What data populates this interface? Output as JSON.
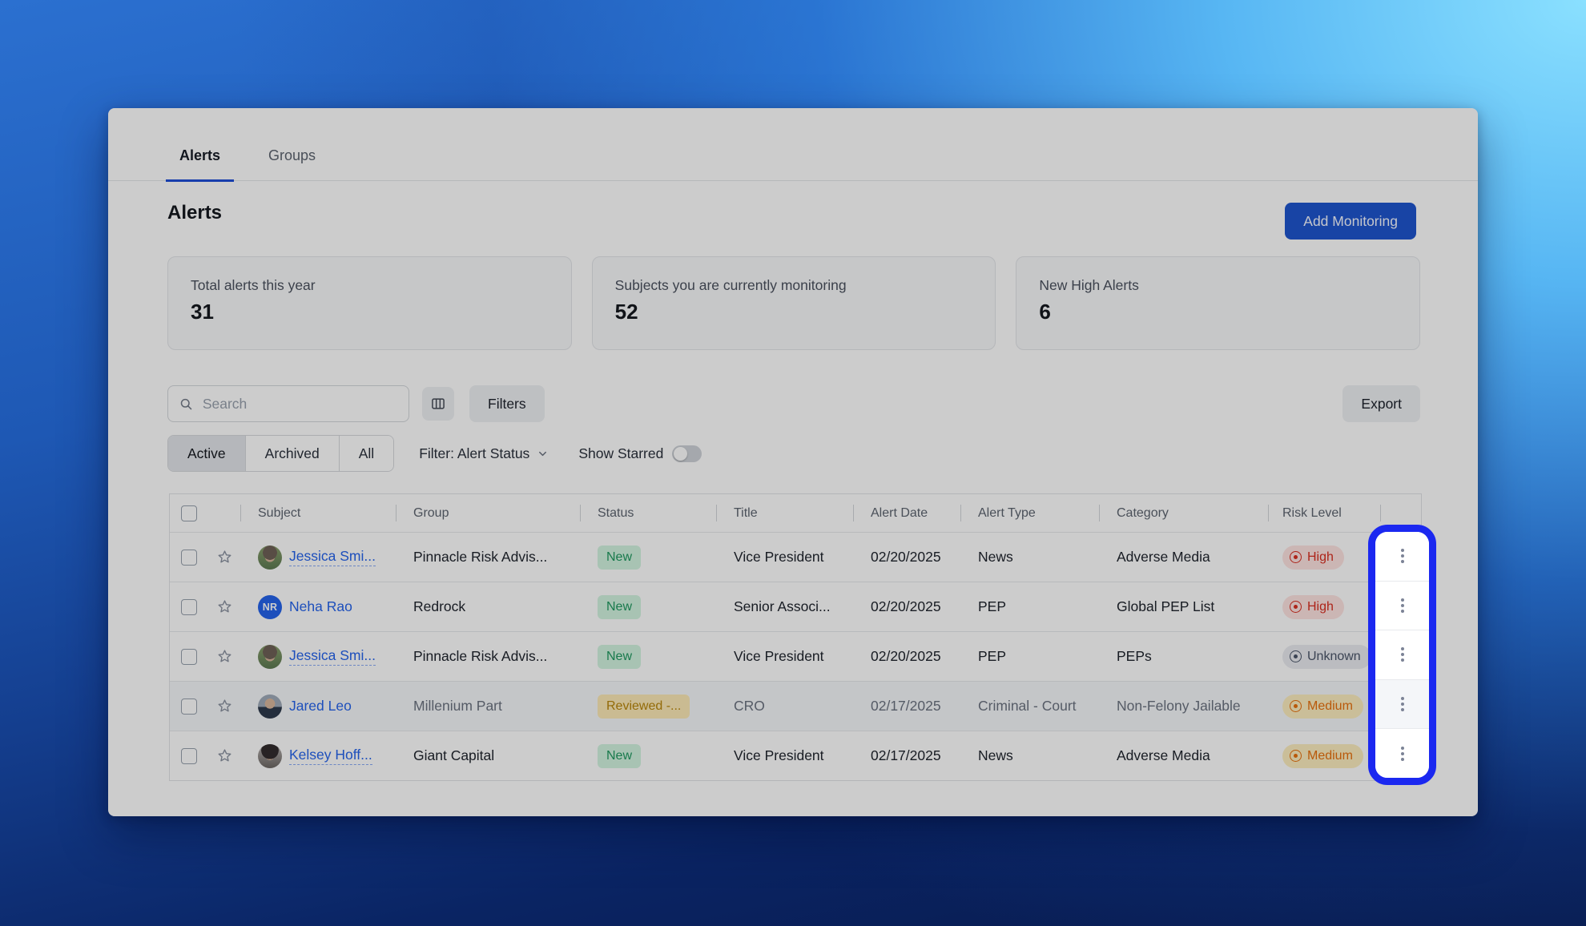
{
  "colors": {
    "accent_blue": "#1e55cf",
    "tab_underline": "#1d4ed8",
    "highlight_ring": "#1b28f0",
    "link_blue": "#2563eb"
  },
  "tabs": {
    "items": [
      {
        "label": "Alerts",
        "active": true
      },
      {
        "label": "Groups",
        "active": false
      }
    ]
  },
  "page": {
    "title": "Alerts",
    "add_monitoring_label": "Add Monitoring"
  },
  "stats": {
    "cards": [
      {
        "label": "Total alerts this year",
        "value": "31"
      },
      {
        "label": "Subjects you are currently monitoring",
        "value": "52"
      },
      {
        "label": "New High Alerts",
        "value": "6"
      }
    ]
  },
  "toolbar": {
    "search_placeholder": "Search",
    "filters_label": "Filters",
    "export_label": "Export"
  },
  "filter_bar": {
    "segments": [
      "Active",
      "Archived",
      "All"
    ],
    "active_segment": "Active",
    "filter_label": "Filter: Alert Status",
    "show_starred_label": "Show Starred",
    "starred_on": false
  },
  "table": {
    "headers": [
      "Subject",
      "Group",
      "Status",
      "Title",
      "Alert Date",
      "Alert Type",
      "Category",
      "Risk Level"
    ],
    "rows": [
      {
        "subject": "Jessica Smi...",
        "group": "Pinnacle Risk Advis...",
        "status": "New",
        "title": "Vice President",
        "alert_date": "02/20/2025",
        "alert_type": "News",
        "category": "Adverse Media",
        "risk": "High",
        "viewed": false
      },
      {
        "subject": "Neha Rao",
        "avatar_initials": "NR",
        "group": "Redrock",
        "status": "New",
        "title": "Senior Associ...",
        "alert_date": "02/20/2025",
        "alert_type": "PEP",
        "category": "Global PEP List",
        "risk": "High",
        "viewed": false
      },
      {
        "subject": "Jessica Smi...",
        "group": "Pinnacle Risk Advis...",
        "status": "New",
        "title": "Vice President",
        "alert_date": "02/20/2025",
        "alert_type": "PEP",
        "category": "PEPs",
        "risk": "Unknown",
        "viewed": false
      },
      {
        "subject": "Jared Leo",
        "group": "Millenium Part",
        "status": "Reviewed -...",
        "title": "CRO",
        "alert_date": "02/17/2025",
        "alert_type": "Criminal - Court",
        "category": "Non-Felony Jailable",
        "risk": "Medium",
        "viewed": true
      },
      {
        "subject": "Kelsey Hoff...",
        "group": "Giant Capital",
        "status": "New",
        "title": "Vice President",
        "alert_date": "02/17/2025",
        "alert_type": "News",
        "category": "Adverse Media",
        "risk": "Medium",
        "viewed": false
      }
    ]
  }
}
